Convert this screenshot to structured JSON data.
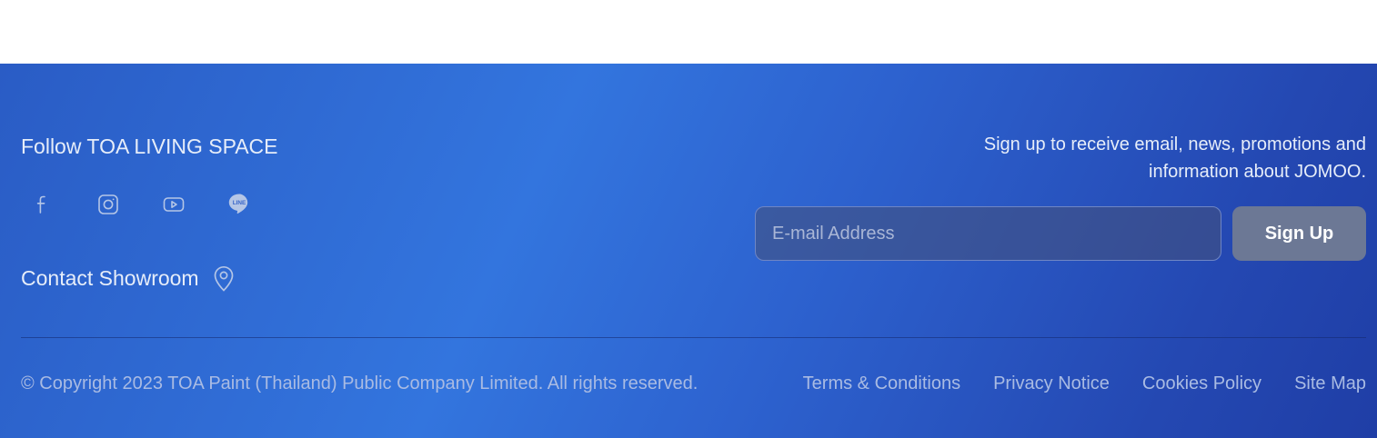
{
  "footer": {
    "follow_title": "Follow TOA LIVING SPACE",
    "social": [
      {
        "icon": "facebook-icon"
      },
      {
        "icon": "instagram-icon"
      },
      {
        "icon": "youtube-icon"
      },
      {
        "icon": "line-icon",
        "text": "LINE"
      }
    ],
    "contact_showroom": "Contact Showroom",
    "contact_icon": "location-pin-icon",
    "signup_text": "Sign up to receive email, news, promotions and information about JOMOO.",
    "email_placeholder": "E-mail Address",
    "email_value": "",
    "signup_button": "Sign Up",
    "copyright": "© Copyright 2023 TOA Paint (Thailand) Public Company Limited. All rights reserved.",
    "links": [
      "Terms & Conditions",
      "Privacy Notice",
      "Cookies Policy",
      "Site Map"
    ]
  },
  "colors": {
    "gradient_start": "#2a5cc5",
    "gradient_mid": "#3375de",
    "gradient_end": "#1f3ea6",
    "button_bg": "#6c7895",
    "text_light": "#e6edf9",
    "text_muted": "#a9bbe3"
  }
}
